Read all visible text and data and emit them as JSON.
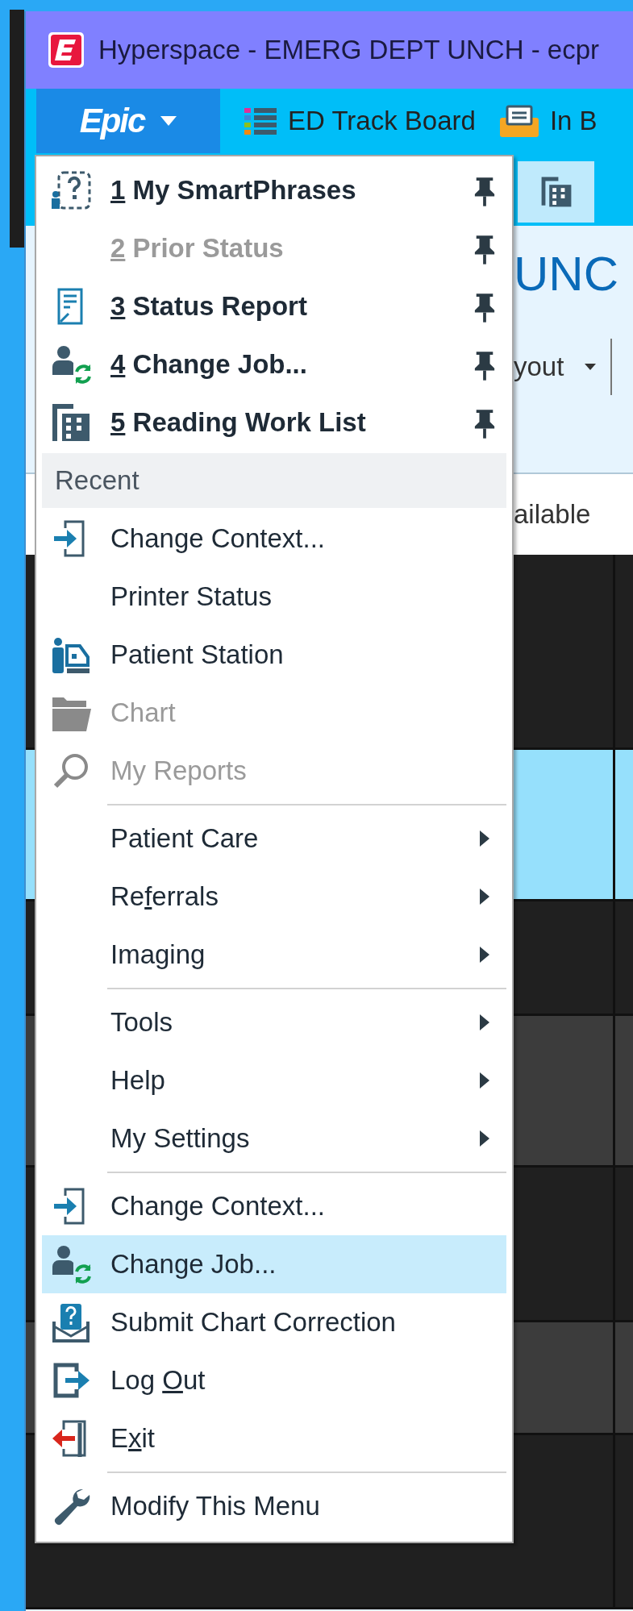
{
  "window": {
    "title": "Hyperspace - EMERG DEPT UNCH - ecpr"
  },
  "toolbar": {
    "epic_button": {
      "label": "Epic",
      "expanded": true
    },
    "items": [
      {
        "label": "ED Track Board"
      },
      {
        "label": "In B"
      }
    ]
  },
  "workspace": {
    "heading": "UNC",
    "layout_label": "yout",
    "column_headers": [
      "ailable"
    ],
    "rows": [
      {
        "selected": false
      },
      {
        "selected": true
      },
      {
        "selected": false
      },
      {
        "selected": false
      },
      {
        "selected": false
      },
      {
        "selected": false
      },
      {
        "selected": false
      }
    ]
  },
  "menu": {
    "items": [
      {
        "kind": "pinned",
        "number": "1",
        "label": "My SmartPhrases",
        "disabled": false,
        "selected": false
      },
      {
        "kind": "pinned",
        "number": "2",
        "label": "Prior Status",
        "disabled": true,
        "selected": false
      },
      {
        "kind": "pinned",
        "number": "3",
        "label": "Status Report",
        "disabled": false,
        "selected": false
      },
      {
        "kind": "pinned",
        "number": "4",
        "label": "Change Job...",
        "disabled": false,
        "selected": false
      },
      {
        "kind": "pinned",
        "number": "5",
        "label": "Reading Work List",
        "disabled": false,
        "selected": false
      },
      {
        "kind": "header",
        "label": "Recent"
      },
      {
        "kind": "item",
        "label": "Change Context...",
        "disabled": false,
        "selected": false,
        "submenu": false
      },
      {
        "kind": "item",
        "label": "Printer Status",
        "disabled": false,
        "selected": false,
        "submenu": false
      },
      {
        "kind": "item",
        "label": "Patient Station",
        "disabled": false,
        "selected": false,
        "submenu": false
      },
      {
        "kind": "item",
        "label": "Chart",
        "disabled": true,
        "selected": false,
        "submenu": false
      },
      {
        "kind": "item",
        "label": "My Reports",
        "disabled": true,
        "selected": false,
        "submenu": false
      },
      {
        "kind": "separator"
      },
      {
        "kind": "item",
        "label": "Patient Care",
        "disabled": false,
        "selected": false,
        "submenu": true
      },
      {
        "kind": "item",
        "label": [
          "Re",
          "f",
          "errals"
        ],
        "disabled": false,
        "selected": false,
        "submenu": true
      },
      {
        "kind": "item",
        "label": "Imaging",
        "disabled": false,
        "selected": false,
        "submenu": true
      },
      {
        "kind": "separator"
      },
      {
        "kind": "item",
        "label": "Tools",
        "disabled": false,
        "selected": false,
        "submenu": true
      },
      {
        "kind": "item",
        "label": "Help",
        "disabled": false,
        "selected": false,
        "submenu": true
      },
      {
        "kind": "item",
        "label": "My Settings",
        "disabled": false,
        "selected": false,
        "submenu": true
      },
      {
        "kind": "separator"
      },
      {
        "kind": "item",
        "label": "Change Context...",
        "disabled": false,
        "selected": false,
        "submenu": false
      },
      {
        "kind": "item",
        "label": "Change Job...",
        "disabled": false,
        "selected": true,
        "submenu": false
      },
      {
        "kind": "item",
        "label": "Submit Chart Correction",
        "disabled": false,
        "selected": false,
        "submenu": false
      },
      {
        "kind": "item",
        "label": [
          "Log ",
          "O",
          "ut"
        ],
        "disabled": false,
        "selected": false,
        "submenu": false
      },
      {
        "kind": "item",
        "label": [
          "E",
          "x",
          "it"
        ],
        "disabled": false,
        "selected": false,
        "submenu": false
      },
      {
        "kind": "separator"
      },
      {
        "kind": "item",
        "label": "Modify This Menu",
        "disabled": false,
        "selected": false,
        "submenu": false
      }
    ]
  }
}
